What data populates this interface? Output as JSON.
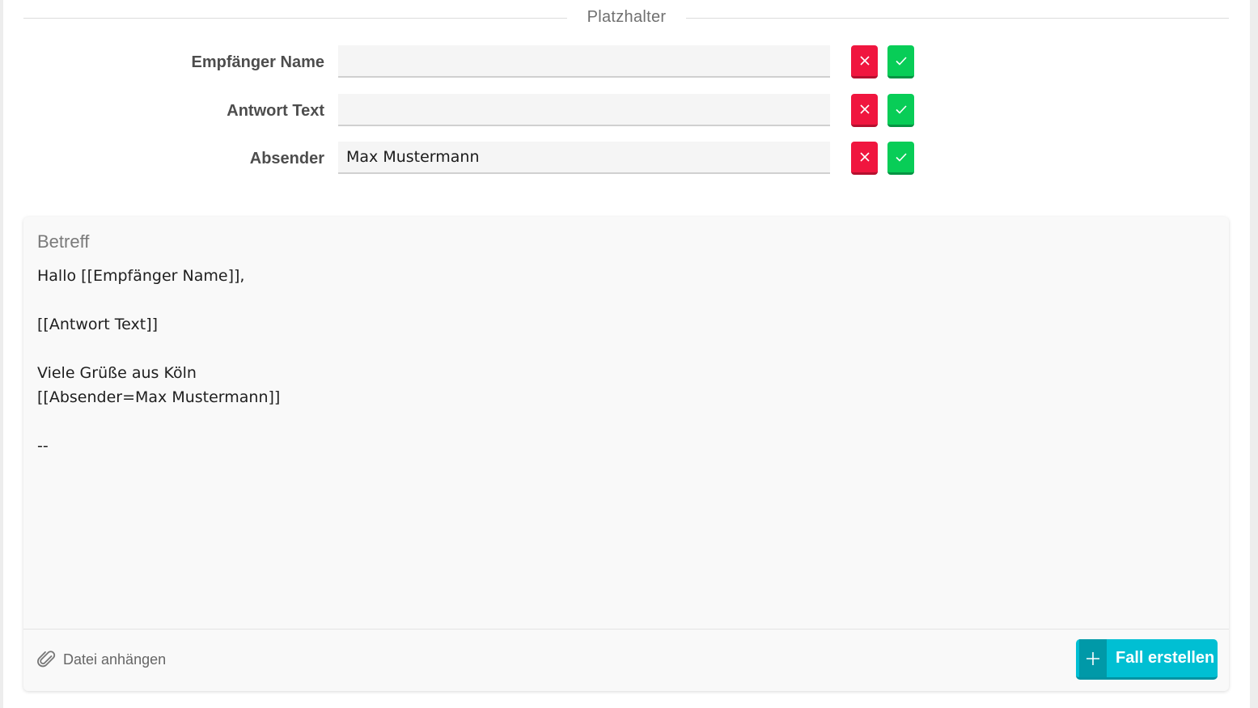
{
  "placeholders": {
    "section_title": "Platzhalter",
    "rows": [
      {
        "label": "Empfänger Name",
        "value": ""
      },
      {
        "label": "Antwort Text",
        "value": ""
      },
      {
        "label": "Absender",
        "value": "Max Mustermann"
      }
    ]
  },
  "editor": {
    "subject_placeholder": "Betreff",
    "body_lines": [
      "Hallo [[Empfänger Name]],",
      "",
      "[[Antwort Text]]",
      "",
      "Viele Grüße aus Köln",
      "[[Absender=Max Mustermann]]",
      "",
      "--"
    ]
  },
  "footer": {
    "attach_label": "Datei anhängen",
    "create_label": "Fall erstellen"
  },
  "icons": {
    "reject": "close-icon",
    "confirm": "check-icon",
    "attach": "paperclip-icon",
    "create": "plus-icon"
  },
  "colors": {
    "reject": "#f0163f",
    "confirm": "#08cd57",
    "primary": "#00bfd3"
  }
}
